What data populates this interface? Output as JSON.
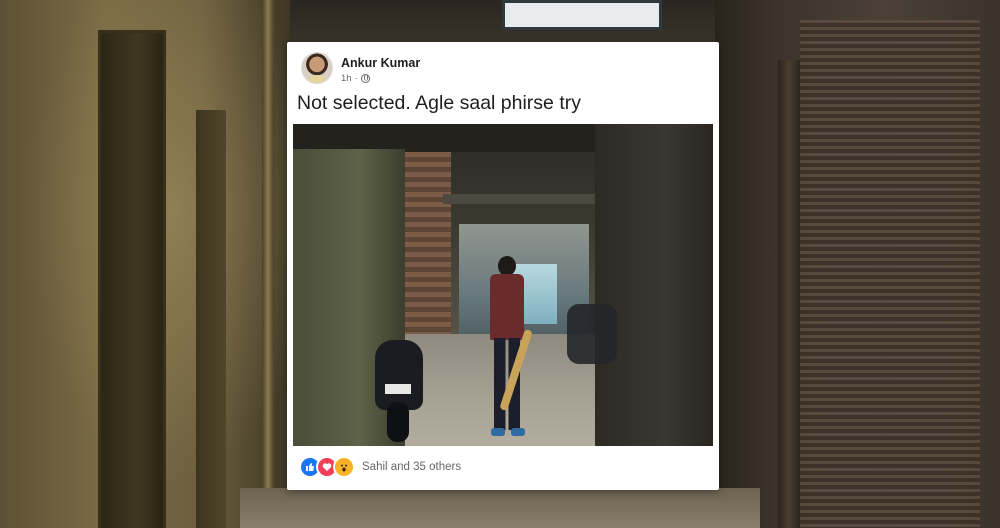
{
  "post": {
    "author": "Ankur Kumar",
    "time": "1h",
    "meta_separator": "·",
    "text": "Not selected. Agle saal phirse try",
    "privacy_icon": "globe-icon",
    "reactions": {
      "icons": [
        "like-icon",
        "love-icon",
        "wow-icon"
      ],
      "summary": "Sahil and 35 others"
    }
  },
  "colors": {
    "card_background": "#ffffff",
    "name_text": "#1c1e21",
    "meta_text": "#65676b",
    "like": "#1877f2",
    "love": "#f33e58",
    "wow": "#f7b125"
  }
}
